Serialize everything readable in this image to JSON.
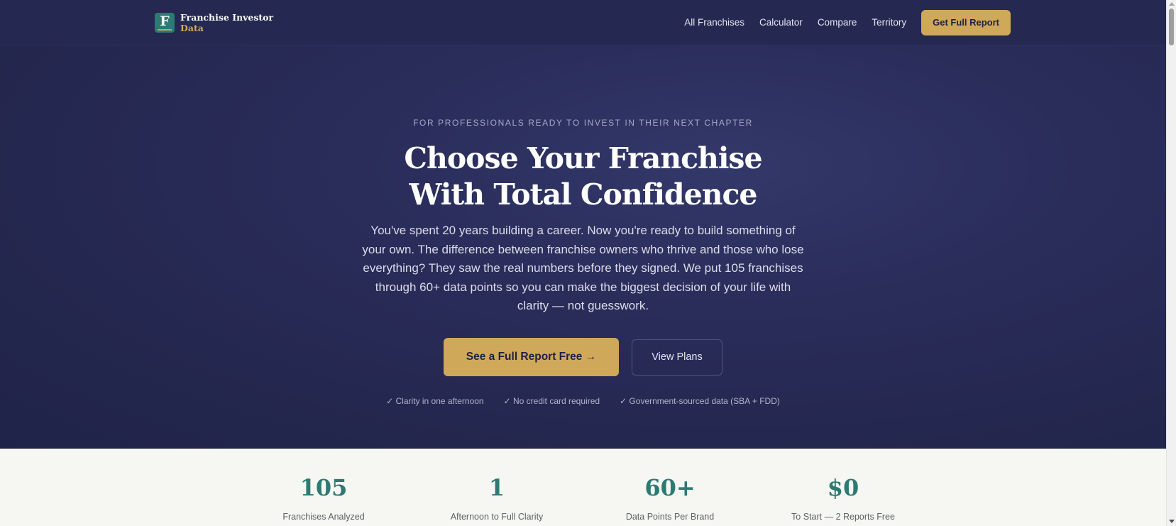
{
  "nav": {
    "brand_letter": "F",
    "brand_name": "Franchise Investor",
    "brand_sub": "Data",
    "links": [
      "All Franchises",
      "Calculator",
      "Compare",
      "Territory"
    ],
    "cta": "Get Full Report"
  },
  "hero": {
    "eyebrow": "FOR PROFESSIONALS READY TO INVEST IN THEIR NEXT CHAPTER",
    "headline_line1": "Choose Your Franchise",
    "headline_line2": "With Total Confidence",
    "lede": "You've spent 20 years building a career. Now you're ready to build something of your own. The difference between franchise owners who thrive and those who lose everything? They saw the real numbers before they signed. We put 105 franchises through 60+ data points so you can make the biggest decision of your life with clarity — not guesswork.",
    "primary_cta": "See a Full Report Free →",
    "secondary_cta": "View Plans",
    "trust": [
      "✓ Clarity in one afternoon",
      "✓ No credit card required",
      "✓ Government-sourced data (SBA + FDD)"
    ]
  },
  "stats": [
    {
      "value": "105",
      "label": "Franchises Analyzed"
    },
    {
      "value": "1",
      "label": "Afternoon to Full Clarity"
    },
    {
      "value": "60+",
      "label": "Data Points Per Brand"
    },
    {
      "value": "$0",
      "label": "To Start — 2 Reports Free"
    }
  ],
  "colors": {
    "navy": "#252850",
    "gold": "#cfa859",
    "teal": "#2d7a73"
  }
}
